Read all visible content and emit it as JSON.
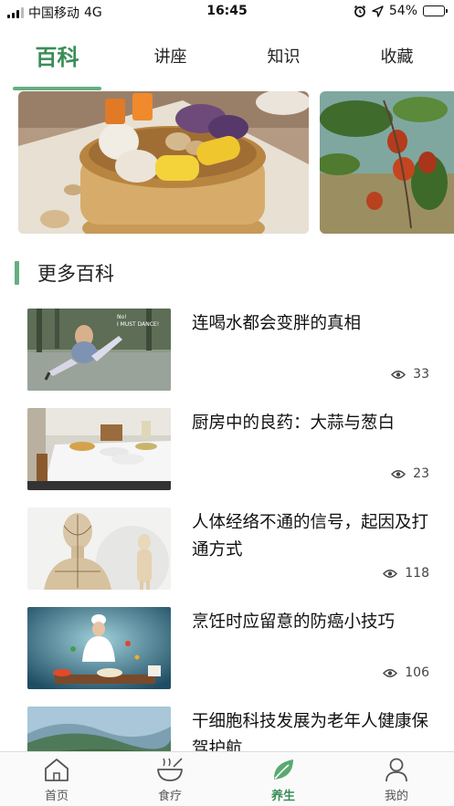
{
  "status_bar": {
    "carrier": "中国移动",
    "network": "4G",
    "time": "16:45",
    "battery": "54%",
    "battery_level": 0.54
  },
  "tabs": [
    {
      "label": "百科",
      "active": true
    },
    {
      "label": "讲座",
      "active": false
    },
    {
      "label": "知识",
      "active": false
    },
    {
      "label": "收藏",
      "active": false
    }
  ],
  "section": {
    "title": "更多百科"
  },
  "articles": [
    {
      "title": "连喝水都会变胖的真相",
      "views": "33",
      "thumb_text": "No!\nI MUST DANCE!"
    },
    {
      "title": "厨房中的良药：大蒜与葱白",
      "views": "23"
    },
    {
      "title": "人体经络不通的信号，起因及打通方式",
      "views": "118"
    },
    {
      "title": "烹饪时应留意的防癌小技巧",
      "views": "106"
    },
    {
      "title": "干细胞科技发展为老年人健康保驾护航",
      "views": ""
    }
  ],
  "bottom_nav": [
    {
      "label": "首页",
      "icon": "home-icon",
      "active": false
    },
    {
      "label": "食疗",
      "icon": "bowl-icon",
      "active": false
    },
    {
      "label": "养生",
      "icon": "leaf-icon",
      "active": true
    },
    {
      "label": "我的",
      "icon": "person-icon",
      "active": false
    }
  ],
  "colors": {
    "accent": "#3a8d57",
    "accent_light": "#63b07f",
    "nav_bg": "#fafafa"
  }
}
